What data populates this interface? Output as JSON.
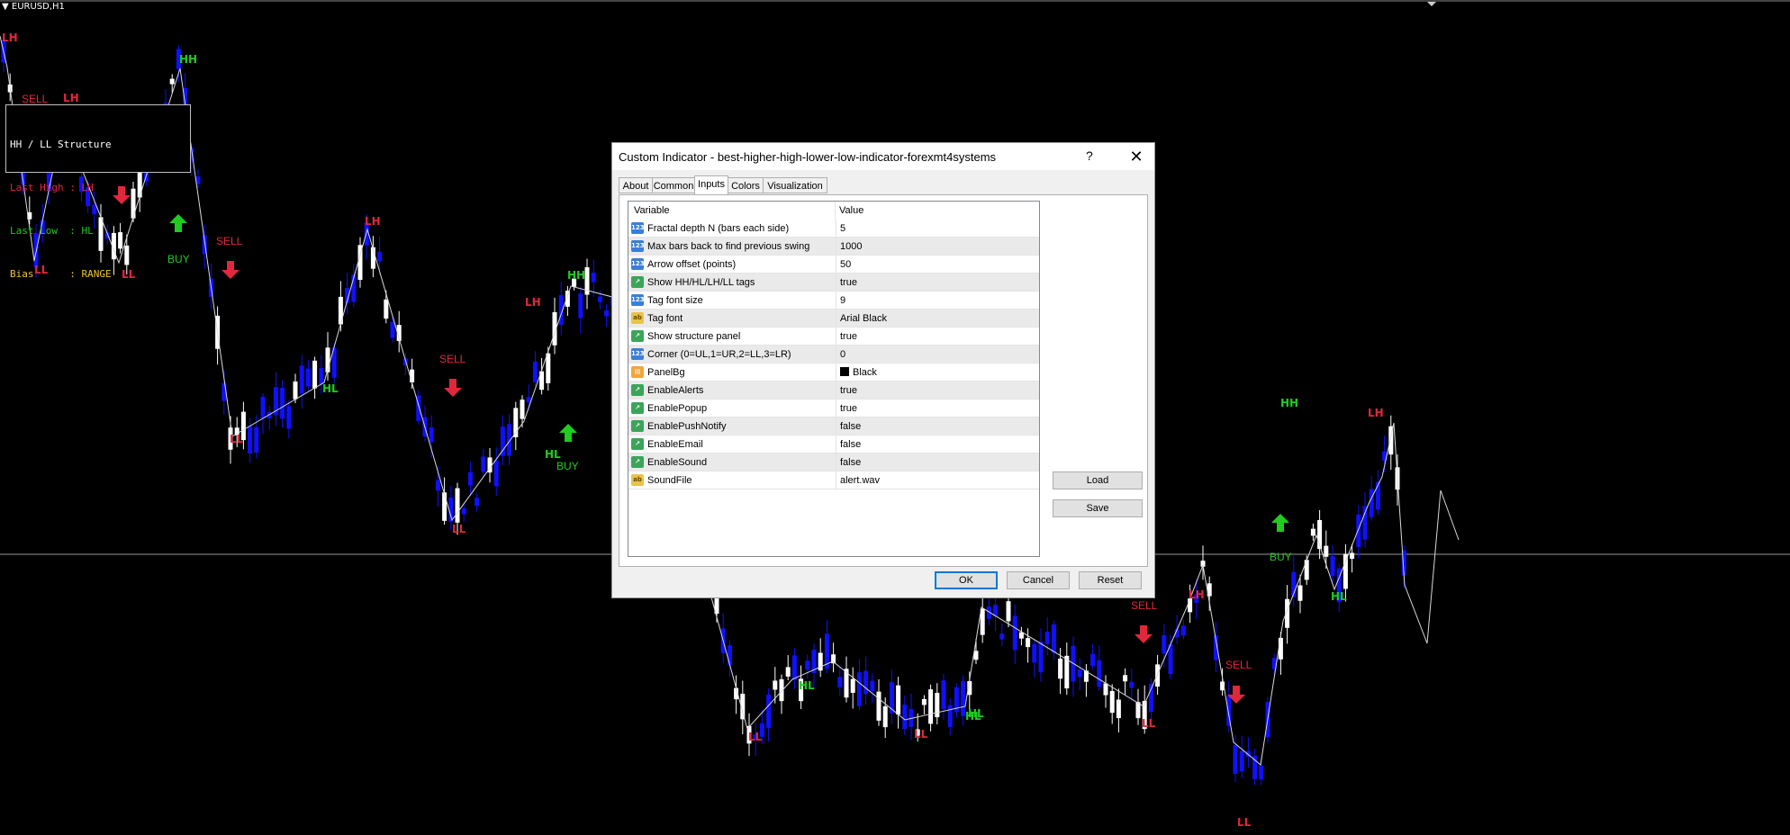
{
  "chart": {
    "symbol": "EURUSD,H1",
    "colors": {
      "hh": "#1fcc1f",
      "ll": "#e0283c",
      "buy": "#1fcc1f",
      "sell": "#e0283c",
      "bull": "#ffffff",
      "bear": "#1010ff",
      "line": "#d9d9d9"
    },
    "tags": [
      {
        "text": "LH",
        "kind": "ll"
      },
      {
        "text": "HH",
        "kind": "hh"
      },
      {
        "text": "LH",
        "kind": "ll"
      },
      {
        "text": "LL",
        "kind": "ll"
      },
      {
        "text": "LL",
        "kind": "ll"
      },
      {
        "text": "LH",
        "kind": "ll"
      },
      {
        "text": "HH",
        "kind": "hh"
      },
      {
        "text": "LH",
        "kind": "ll"
      },
      {
        "text": "HL",
        "kind": "hh"
      },
      {
        "text": "LL",
        "kind": "ll"
      },
      {
        "text": "LL",
        "kind": "ll"
      },
      {
        "text": "HL",
        "kind": "hh"
      },
      {
        "text": "HH",
        "kind": "hh"
      },
      {
        "text": "LH",
        "kind": "ll"
      },
      {
        "text": "HL",
        "kind": "hh"
      },
      {
        "text": "LH",
        "kind": "ll"
      },
      {
        "text": "LL",
        "kind": "ll"
      },
      {
        "text": "HL",
        "kind": "hh"
      },
      {
        "text": "LL",
        "kind": "ll"
      },
      {
        "text": "HL",
        "kind": "hh"
      },
      {
        "text": "LL",
        "kind": "ll"
      },
      {
        "text": "LL",
        "kind": "ll"
      },
      {
        "text": "HL",
        "kind": "hh"
      }
    ],
    "signals": [
      {
        "text": "SELL",
        "kind": "sell"
      },
      {
        "text": "BUY",
        "kind": "buy"
      },
      {
        "text": "SELL",
        "kind": "sell"
      },
      {
        "text": "SELL",
        "kind": "sell"
      },
      {
        "text": "BUY",
        "kind": "buy"
      },
      {
        "text": "SELL",
        "kind": "sell"
      },
      {
        "text": "SELL",
        "kind": "sell"
      },
      {
        "text": "BUY",
        "kind": "buy"
      }
    ]
  },
  "panel": {
    "title": "HH / LL Structure",
    "last_high": "Last High : LH",
    "last_low": "Last Low  : HL",
    "bias": "Bias      : RANGE",
    "colors": {
      "title": "#ffffff",
      "high": "#e0283c",
      "low": "#1fcc1f",
      "bias": "#f2c230"
    }
  },
  "dialog": {
    "title": "Custom Indicator - best-higher-high-lower-low-indicator-forexmt4systems",
    "help": "?",
    "close": "✕",
    "tabs": [
      "About",
      "Common",
      "Inputs",
      "Colors",
      "Visualization"
    ],
    "active_tab": "Inputs",
    "columns": {
      "variable": "Variable",
      "value": "Value"
    },
    "params": [
      {
        "icon": "num",
        "name": "Fractal depth N (bars each side)",
        "value": "5"
      },
      {
        "icon": "num",
        "name": "Max bars back to find previous swing",
        "value": "1000"
      },
      {
        "icon": "num",
        "name": "Arrow offset (points)",
        "value": "50"
      },
      {
        "icon": "bool",
        "name": "Show HH/HL/LH/LL tags",
        "value": "true"
      },
      {
        "icon": "num",
        "name": "Tag font size",
        "value": "9"
      },
      {
        "icon": "str",
        "name": "Tag font",
        "value": "Arial Black"
      },
      {
        "icon": "bool",
        "name": "Show structure panel",
        "value": "true"
      },
      {
        "icon": "num",
        "name": "Corner (0=UL,1=UR,2=LL,3=LR)",
        "value": "0"
      },
      {
        "icon": "col",
        "name": "PanelBg",
        "value": "Black"
      },
      {
        "icon": "bool",
        "name": "EnableAlerts",
        "value": "true"
      },
      {
        "icon": "bool",
        "name": "EnablePopup",
        "value": "true"
      },
      {
        "icon": "bool",
        "name": "EnablePushNotify",
        "value": "false"
      },
      {
        "icon": "bool",
        "name": "EnableEmail",
        "value": "false"
      },
      {
        "icon": "bool",
        "name": "EnableSound",
        "value": "false"
      },
      {
        "icon": "str",
        "name": "SoundFile",
        "value": "alert.wav"
      }
    ],
    "buttons": {
      "load": "Load",
      "save": "Save",
      "ok": "OK",
      "cancel": "Cancel",
      "reset": "Reset"
    }
  }
}
